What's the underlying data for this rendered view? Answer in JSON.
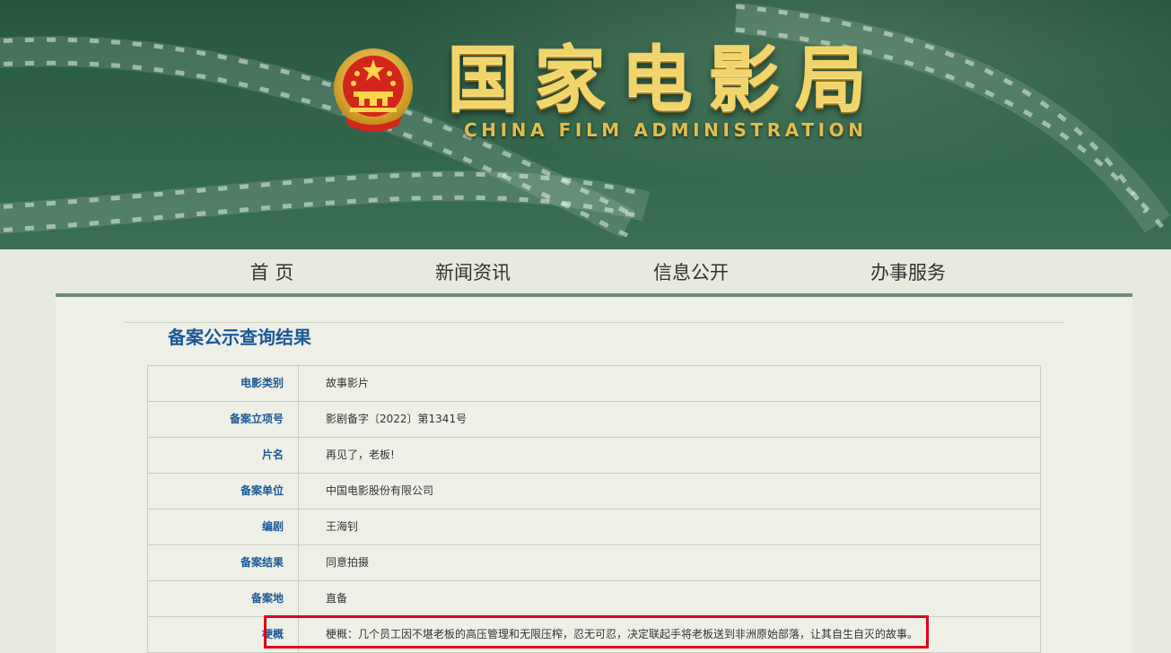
{
  "header": {
    "title_cn": "国家电影局",
    "title_en": "CHINA FILM ADMINISTRATION",
    "emblem": "national-emblem-icon"
  },
  "nav": {
    "items": [
      {
        "label": "首 页"
      },
      {
        "label": "新闻资讯"
      },
      {
        "label": "信息公开"
      },
      {
        "label": "办事服务"
      }
    ]
  },
  "main": {
    "page_title": "备案公示查询结果",
    "rows": [
      {
        "label": "电影类别",
        "value": "故事影片"
      },
      {
        "label": "备案立项号",
        "value": "影剧备字〔2022〕第1341号"
      },
      {
        "label": "片名",
        "value": "再见了，老板!"
      },
      {
        "label": "备案单位",
        "value": "中国电影股份有限公司"
      },
      {
        "label": "编剧",
        "value": "王海钊"
      },
      {
        "label": "备案结果",
        "value": "同意拍摄"
      },
      {
        "label": "备案地",
        "value": "直备"
      },
      {
        "label": "梗概",
        "value": "梗概：几个员工因不堪老板的高压管理和无限压榨，忍无可忍，决定联起手将老板送到非洲原始部落，让其自生自灭的故事。"
      }
    ]
  },
  "colors": {
    "banner": "#31654a",
    "gold": "#f1d46a",
    "accent_blue": "#1d5896",
    "highlight_red": "#e0001a"
  }
}
